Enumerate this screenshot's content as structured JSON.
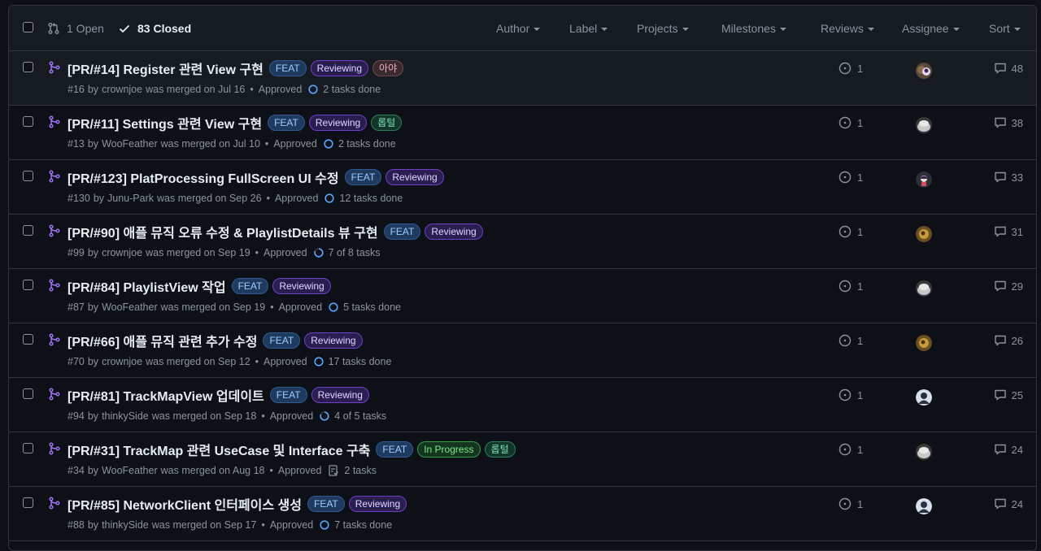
{
  "header": {
    "open_label": "1 Open",
    "closed_label": "83 Closed",
    "filters": [
      "Author",
      "Label",
      "Projects",
      "Milestones",
      "Reviews",
      "Assignee",
      "Sort"
    ]
  },
  "colors": {
    "merged": "#a371f7",
    "task_ring": "#58a6ff"
  },
  "pulls": [
    {
      "title": "[PR/#14] Register 관련 View 구현",
      "labels": [
        {
          "text": "FEAT",
          "kind": "feat"
        },
        {
          "text": "Reviewing",
          "kind": "reviewing"
        },
        {
          "text": "아야",
          "kind": "aya"
        }
      ],
      "number": "#16",
      "by": "by",
      "author": "crownjoe",
      "merged_text": "was merged on Jul 16",
      "approval": "Approved",
      "tasks": "2 tasks done",
      "task_icon": "progress-ring",
      "linked_issues": "1",
      "assignee_avatar": "double-avatar",
      "comments": "48"
    },
    {
      "title": "[PR/#11] Settings 관련 View 구현",
      "labels": [
        {
          "text": "FEAT",
          "kind": "feat"
        },
        {
          "text": "Reviewing",
          "kind": "reviewing"
        },
        {
          "text": "롭털",
          "kind": "green"
        }
      ],
      "number": "#13",
      "by": "by",
      "author": "WooFeather",
      "merged_text": "was merged on Jul 10",
      "approval": "Approved",
      "tasks": "2 tasks done",
      "task_icon": "progress-ring",
      "linked_issues": "1",
      "assignee_avatar": "grey-avatar",
      "comments": "38"
    },
    {
      "title": "[PR/#123] PlatProcessing FullScreen UI 수정",
      "labels": [
        {
          "text": "FEAT",
          "kind": "feat"
        },
        {
          "text": "Reviewing",
          "kind": "reviewing"
        }
      ],
      "number": "#130",
      "by": "by",
      "author": "Junu-Park",
      "merged_text": "was merged on Sep 26",
      "approval": "Approved",
      "tasks": "12 tasks done",
      "task_icon": "progress-ring",
      "linked_issues": "1",
      "assignee_avatar": "character-avatar",
      "comments": "33"
    },
    {
      "title": "[PR/#90] 애플 뮤직 오류 수정 & PlaylistDetails 뷰 구현",
      "labels": [
        {
          "text": "FEAT",
          "kind": "feat"
        },
        {
          "text": "Reviewing",
          "kind": "reviewing"
        }
      ],
      "number": "#99",
      "by": "by",
      "author": "crownjoe",
      "merged_text": "was merged on Sep 19",
      "approval": "Approved",
      "tasks": "7 of 8 tasks",
      "task_icon": "progress-ring",
      "linked_issues": "1",
      "assignee_avatar": "gold-avatar",
      "comments": "31"
    },
    {
      "title": "[PR/#84] PlaylistView 작업",
      "labels": [
        {
          "text": "FEAT",
          "kind": "feat"
        },
        {
          "text": "Reviewing",
          "kind": "reviewing"
        }
      ],
      "number": "#87",
      "by": "by",
      "author": "WooFeather",
      "merged_text": "was merged on Sep 19",
      "approval": "Approved",
      "tasks": "5 tasks done",
      "task_icon": "progress-ring",
      "linked_issues": "1",
      "assignee_avatar": "grey-avatar",
      "comments": "29"
    },
    {
      "title": "[PR/#66] 애플 뮤직 관련 추가 수정",
      "labels": [
        {
          "text": "FEAT",
          "kind": "feat"
        },
        {
          "text": "Reviewing",
          "kind": "reviewing"
        }
      ],
      "number": "#70",
      "by": "by",
      "author": "crownjoe",
      "merged_text": "was merged on Sep 12",
      "approval": "Approved",
      "tasks": "17 tasks done",
      "task_icon": "progress-ring",
      "linked_issues": "1",
      "assignee_avatar": "gold-avatar",
      "comments": "26"
    },
    {
      "title": "[PR/#81] TrackMapView 업데이트",
      "labels": [
        {
          "text": "FEAT",
          "kind": "feat"
        },
        {
          "text": "Reviewing",
          "kind": "reviewing"
        }
      ],
      "number": "#94",
      "by": "by",
      "author": "thinkySide",
      "merged_text": "was merged on Sep 18",
      "approval": "Approved",
      "tasks": "4 of 5 tasks",
      "task_icon": "progress-ring",
      "linked_issues": "1",
      "assignee_avatar": "dark-avatar",
      "comments": "25"
    },
    {
      "title": "[PR/#31] TrackMap 관련 UseCase 및 Interface 구축",
      "labels": [
        {
          "text": "FEAT",
          "kind": "feat"
        },
        {
          "text": "In Progress",
          "kind": "inprogress"
        },
        {
          "text": "롭털",
          "kind": "green"
        }
      ],
      "number": "#34",
      "by": "by",
      "author": "WooFeather",
      "merged_text": "was merged on Aug 18",
      "approval": "Approved",
      "tasks": "2 tasks",
      "task_icon": "checklist",
      "linked_issues": "1",
      "assignee_avatar": "grey-avatar",
      "comments": "24"
    },
    {
      "title": "[PR/#85] NetworkClient 인터페이스 생성",
      "labels": [
        {
          "text": "FEAT",
          "kind": "feat"
        },
        {
          "text": "Reviewing",
          "kind": "reviewing"
        }
      ],
      "number": "#88",
      "by": "by",
      "author": "thinkySide",
      "merged_text": "was merged on Sep 17",
      "approval": "Approved",
      "tasks": "7 tasks done",
      "task_icon": "progress-ring",
      "linked_issues": "1",
      "assignee_avatar": "dark-avatar",
      "comments": "24"
    }
  ]
}
